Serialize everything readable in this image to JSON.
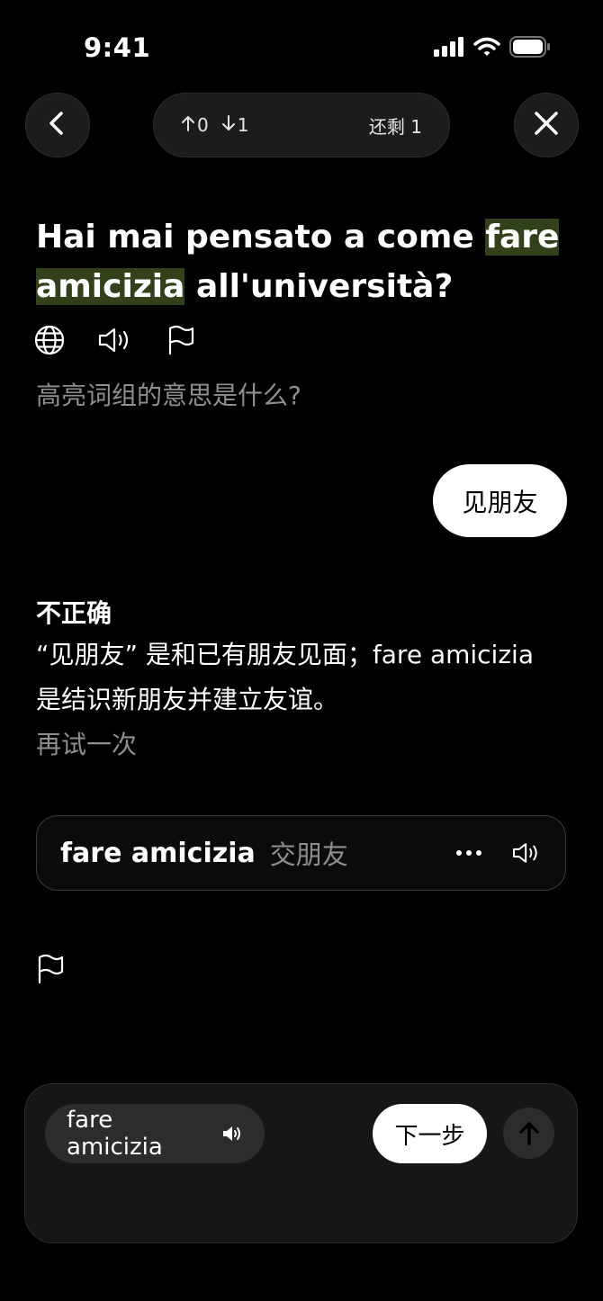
{
  "status_bar": {
    "time": "9:41"
  },
  "header": {
    "up_count": "0",
    "down_count": "1",
    "remaining": "还剩 1"
  },
  "question": {
    "sentence_before": "Hai mai pensato a come ",
    "highlight_1": "fare",
    "between": " ",
    "highlight_2": "amicizia",
    "sentence_after": " all'università?",
    "prompt": "高亮词组的意思是什么?"
  },
  "answer": {
    "label": "见朋友"
  },
  "feedback": {
    "title": "不正确",
    "explanation": "“见朋友” 是和已有朋友见面；fare amicizia 是结识新朋友并建立友谊。",
    "retry": "再试一次"
  },
  "phrase_card": {
    "word": "fare amicizia",
    "translation": "交朋友"
  },
  "bottom": {
    "chip_label": "fare amicizia",
    "next_label": "下一步"
  },
  "colors": {
    "highlight": "#33411a",
    "background": "#000000",
    "muted_text": "#8e8e93"
  }
}
